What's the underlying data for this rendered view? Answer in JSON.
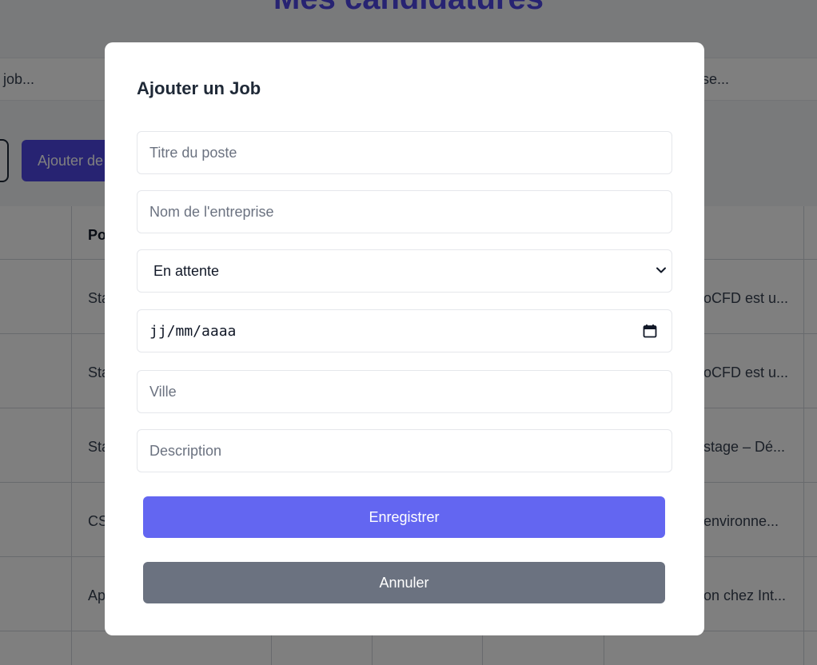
{
  "page": {
    "title": "Mes candidatures",
    "filter_left_placeholder": "job...",
    "filter_right_placeholder": "rise...",
    "add_button_label": "Ajouter de"
  },
  "table": {
    "header": "Po",
    "rows": [
      {
        "left": "Sta",
        "right": "oCFD est u..."
      },
      {
        "left": "Sta",
        "right": "oCFD est u..."
      },
      {
        "left": "Sta",
        "right": "stage – Dé..."
      },
      {
        "left": "CS",
        "right": "environne..."
      },
      {
        "left": "Ap",
        "right": "on chez Int..."
      }
    ]
  },
  "modal": {
    "title": "Ajouter un Job",
    "fields": {
      "job_title_placeholder": "Titre du poste",
      "company_placeholder": "Nom de l'entreprise",
      "status_selected": "En attente",
      "date_placeholder": "jj/mm/aaaa",
      "city_placeholder": "Ville",
      "description_placeholder": "Description"
    },
    "save_label": "Enregistrer",
    "cancel_label": "Annuler"
  },
  "colors": {
    "primary": "#6366f1",
    "secondary": "#6b7280",
    "brand": "#4f46e5"
  }
}
